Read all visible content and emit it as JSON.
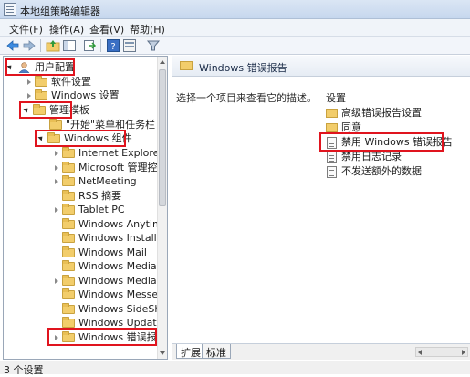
{
  "window": {
    "title": "本地组策略编辑器"
  },
  "menu": [
    "文件(F)",
    "操作(A)",
    "查看(V)",
    "帮助(H)"
  ],
  "toolbar": {
    "buttons": [
      "back-icon",
      "forward-icon",
      "up-folder-icon",
      "show-hide-tree-icon",
      "export-list-icon",
      "help-icon",
      "properties-icon",
      "filter-icon"
    ]
  },
  "tree": {
    "user_config": "用户配置",
    "software_settings": "软件设置",
    "windows_settings": "Windows 设置",
    "admin_templates": "管理模板",
    "start_menu": "\"开始\"菜单和任务栏",
    "windows_components": "Windows 组件",
    "children": [
      "Internet Explorer",
      "Microsoft 管理控制",
      "NetMeeting",
      "RSS 摘要",
      "Tablet PC",
      "Windows Anytime U",
      "Windows Installer",
      "Windows Mail",
      "Windows Media Ce",
      "Windows Media Pla",
      "Windows Messeng",
      "Windows SideShow",
      "Windows Update",
      "Windows 错误报告"
    ]
  },
  "right": {
    "header": "Windows 错误报告",
    "description": "选择一个项目来查看它的描述。",
    "list_header": "设置",
    "items": [
      {
        "label": "高级错误报告设置",
        "icon": "folder-icon"
      },
      {
        "label": "同意",
        "icon": "folder-icon"
      },
      {
        "label": "禁用 Windows 错误报告",
        "icon": "policy-setting-icon"
      },
      {
        "label": "禁用日志记录",
        "icon": "policy-setting-icon"
      },
      {
        "label": "不发送额外的数据",
        "icon": "policy-setting-icon"
      }
    ]
  },
  "tabs": [
    "扩展",
    "标准"
  ],
  "status": "3 个设置",
  "colors": {
    "highlight_box": "#e0141e",
    "folder": "#f2cd6b",
    "titlebar": "#c6d7ee"
  }
}
